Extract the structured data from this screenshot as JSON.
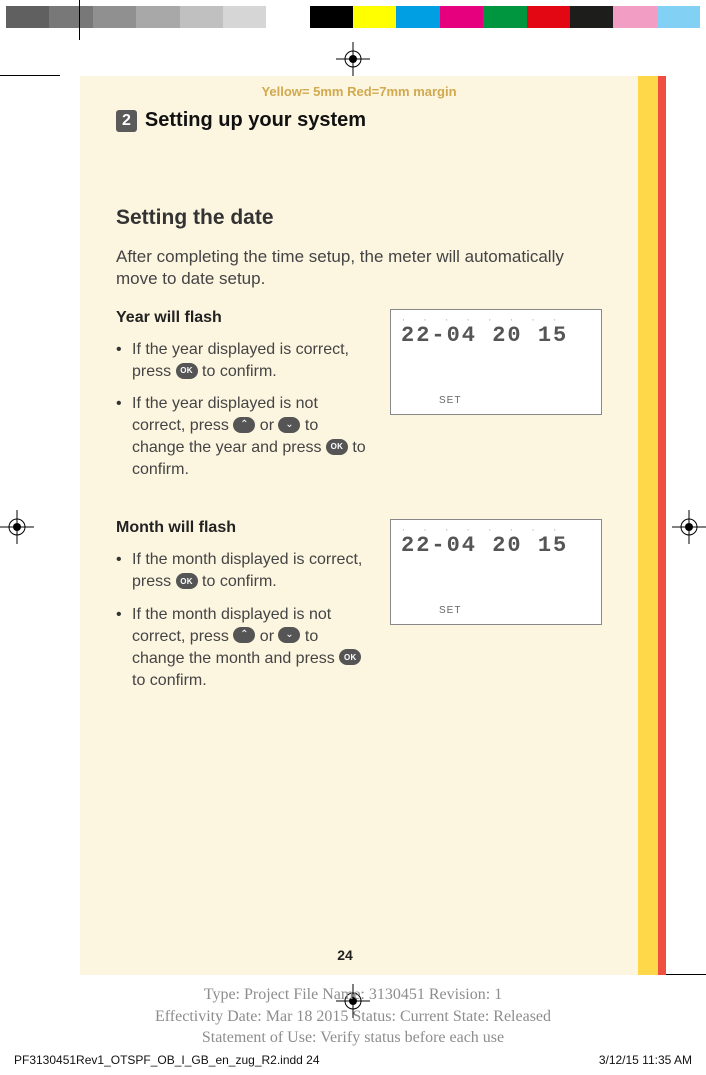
{
  "colorbar": [
    "#606060",
    "#787878",
    "#909090",
    "#a8a8a8",
    "#c0c0c0",
    "#d6d6d6",
    "#ffffff",
    "#000000",
    "#ffff00",
    "#009fe3",
    "#e6007e",
    "#009640",
    "#e30613",
    "#1d1d1b",
    "#f29ec4",
    "#83d0f5"
  ],
  "margins_note": "Yellow= 5mm  Red=7mm margin",
  "chapter": {
    "num": "2",
    "title": "Setting up your system"
  },
  "section_title": "Setting the date",
  "intro": "After completing the time setup, the meter will automatically move to date setup.",
  "blocks": [
    {
      "heading": "Year will flash",
      "items": [
        {
          "pre": "If the year displayed is correct, press ",
          "btn1": "ok",
          "mid": " to confirm.",
          "btn2": null,
          "post": ""
        },
        {
          "pre": "If the year displayed is not correct, press ",
          "btn1": "up",
          "mid": " or ",
          "btn2": "down",
          "mid2": " to change the year and press ",
          "btn3": "ok",
          "post": " to confirm."
        }
      ],
      "lcd": {
        "line": "22-04  20 15",
        "set": "SET"
      }
    },
    {
      "heading": "Month will flash",
      "items": [
        {
          "pre": "If the month displayed is correct, press ",
          "btn1": "ok",
          "mid": " to confirm.",
          "btn2": null,
          "post": ""
        },
        {
          "pre": "If the month displayed is not correct, press ",
          "btn1": "up",
          "mid": " or ",
          "btn2": "down",
          "mid2": " to change the month and press ",
          "btn3": "ok",
          "post": " to confirm."
        }
      ],
      "lcd": {
        "line": "22-04  20 15",
        "set": "SET"
      }
    }
  ],
  "page_number": "24",
  "meta": {
    "l1": "Type: Project File  Name: 3130451  Revision: 1",
    "l2": "Effectivity Date: Mar 18 2015     Status: Current     State: Released",
    "l3": "Statement of Use: Verify status before each use"
  },
  "slug": "PF3130451Rev1_OTSPF_OB_I_GB_en_zug_R2.indd   24",
  "stamp": "3/12/15   11:35 AM"
}
